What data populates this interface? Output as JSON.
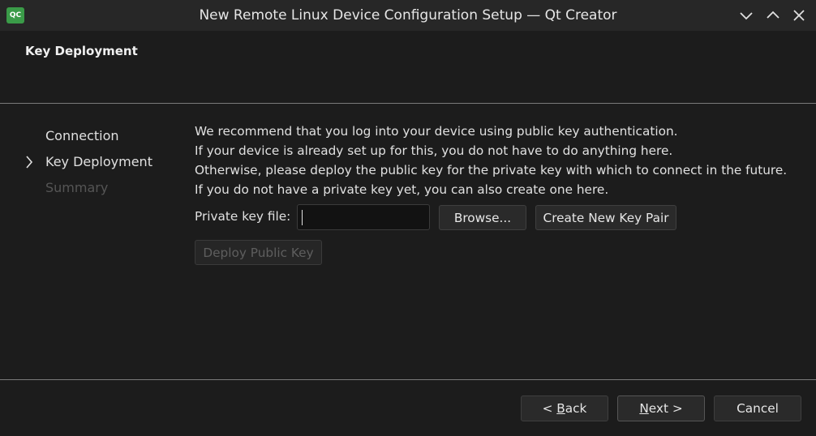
{
  "window": {
    "title": "New Remote Linux Device Configuration Setup — Qt Creator",
    "app_icon_label": "QC",
    "icons": [
      "qt-creator-icon",
      "minimize-icon",
      "maximize-icon",
      "close-icon"
    ]
  },
  "header": {
    "title": "Key Deployment"
  },
  "nav": {
    "items": [
      {
        "label": "Connection",
        "state": "done"
      },
      {
        "label": "Key Deployment",
        "state": "current"
      },
      {
        "label": "Summary",
        "state": "pending"
      }
    ]
  },
  "content": {
    "lines": [
      "We recommend that you log into your device using public key authentication.",
      "If your device is already set up for this, you do not have to do anything here.",
      "Otherwise, please deploy the public key for the private key with which to connect in the future.",
      "If you do not have a private key yet, you can also create one here."
    ],
    "private_key_label": "Private key file:",
    "private_key_value": "",
    "browse_label": "Browse...",
    "create_key_label": "Create New Key Pair",
    "deploy_label": "Deploy Public Key"
  },
  "footer": {
    "back_prefix": "< ",
    "back_mnemonic": "B",
    "back_rest": "ack",
    "next_mnemonic": "N",
    "next_rest": "ext >",
    "cancel_label": "Cancel"
  },
  "colors": {
    "background": "#1c1c1c",
    "titlebar": "#272727",
    "app_icon": "#3a9b48",
    "text": "#e0e0e0",
    "disabled_text": "#555555"
  }
}
